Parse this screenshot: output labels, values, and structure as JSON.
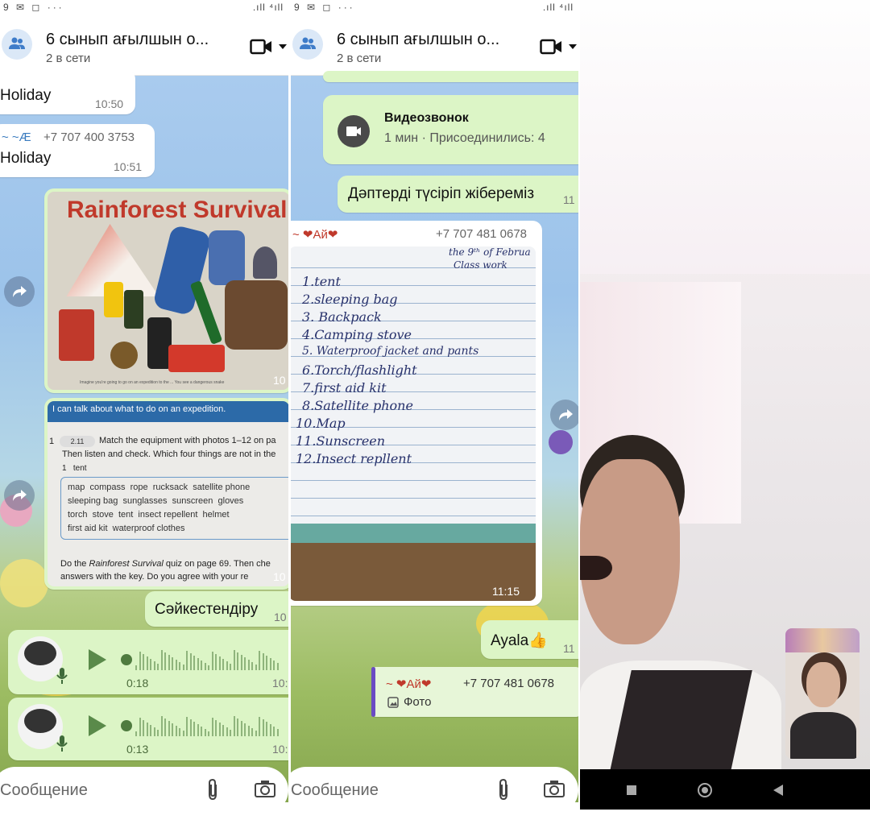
{
  "panel1": {
    "status_left": "9 ✉ ◻ ···",
    "status_right": ".ıll ⁴ıll",
    "header": {
      "title": "6 сынып ағылшын о...",
      "subtitle": "2 в сети"
    },
    "messages": {
      "m1": {
        "text": "Holiday",
        "time": "10:50"
      },
      "m2": {
        "sender": "~ ~Æ",
        "phone": "+7 707 400 3753",
        "text": "Holiday",
        "time": "10:51"
      },
      "photo1": {
        "title": "Rainforest Survival",
        "time": "10",
        "caption": "Imagine you're going to go on an expedition to the ... You see a dangerous snake"
      },
      "photo2": {
        "heading": "I can talk about what to do on an expedition.",
        "exercise": "1",
        "audio_track": "2.11",
        "instruction_1": "Match the equipment with photos 1–12 on pa",
        "instruction_2": "Then listen and check. Which four things are not in the",
        "example": "1   tent",
        "wordbox": [
          "map  compass  rope  rucksack  satellite phone",
          "sleeping bag  sunglasses  sunscreen  gloves",
          "torch  stove  tent  insect repellent  helmet",
          "first aid kit  waterproof clothes"
        ],
        "task_2_pre": "Do the ",
        "task_2_italic": "Rainforest Survival",
        "task_2_post": " quiz on page 69. Then che",
        "task_2_line2": "answers with the key. Do you agree with your re",
        "time": "10"
      },
      "m3": {
        "text": "Сәйкестендіру",
        "time": "10"
      },
      "voice1": {
        "duration": "0:18",
        "time": "10:"
      },
      "voice2": {
        "duration": "0:13",
        "time": "10:"
      }
    },
    "input_placeholder": "Сообщение"
  },
  "panel2": {
    "status_left": "9 ✉ ◻ ···",
    "status_right": ".ıll ⁴ıll",
    "header": {
      "title": "6 сынып ағылшын о...",
      "subtitle": "2 в сети"
    },
    "messages": {
      "call": {
        "title": "Видеозвонок",
        "detail": "1 мин · Присоединились: 4"
      },
      "m1": {
        "text": "Дәптерді түсіріп жібереміз",
        "time": "11"
      },
      "photo": {
        "sender": "~ ❤Ай❤",
        "phone": "+7 707 481 0678",
        "time": "11:15",
        "header_note": "the 9ᵗʰ of Februa",
        "header_note2": "Class  work",
        "lines": [
          "1.tent",
          "2.sleeping bag",
          "3. Backpack",
          "4.Camping stove",
          "5. Waterproof jacket and pants",
          "6.Torch/flashlight",
          "7.first aid kit",
          "8.Satellite phone",
          "10.Map",
          "11.Sunscreen",
          "12.Insect repllent"
        ]
      },
      "m2": {
        "text": "Ayala👍",
        "time": "11"
      },
      "reply": {
        "sender": "~ ❤Ай❤",
        "phone": "+7 707 481 0678",
        "label": "Фото"
      }
    },
    "input_placeholder": "Сообщение"
  },
  "panel3": {
    "nav": {
      "recent": "recents-icon",
      "home": "home-icon",
      "back": "back-icon"
    }
  }
}
